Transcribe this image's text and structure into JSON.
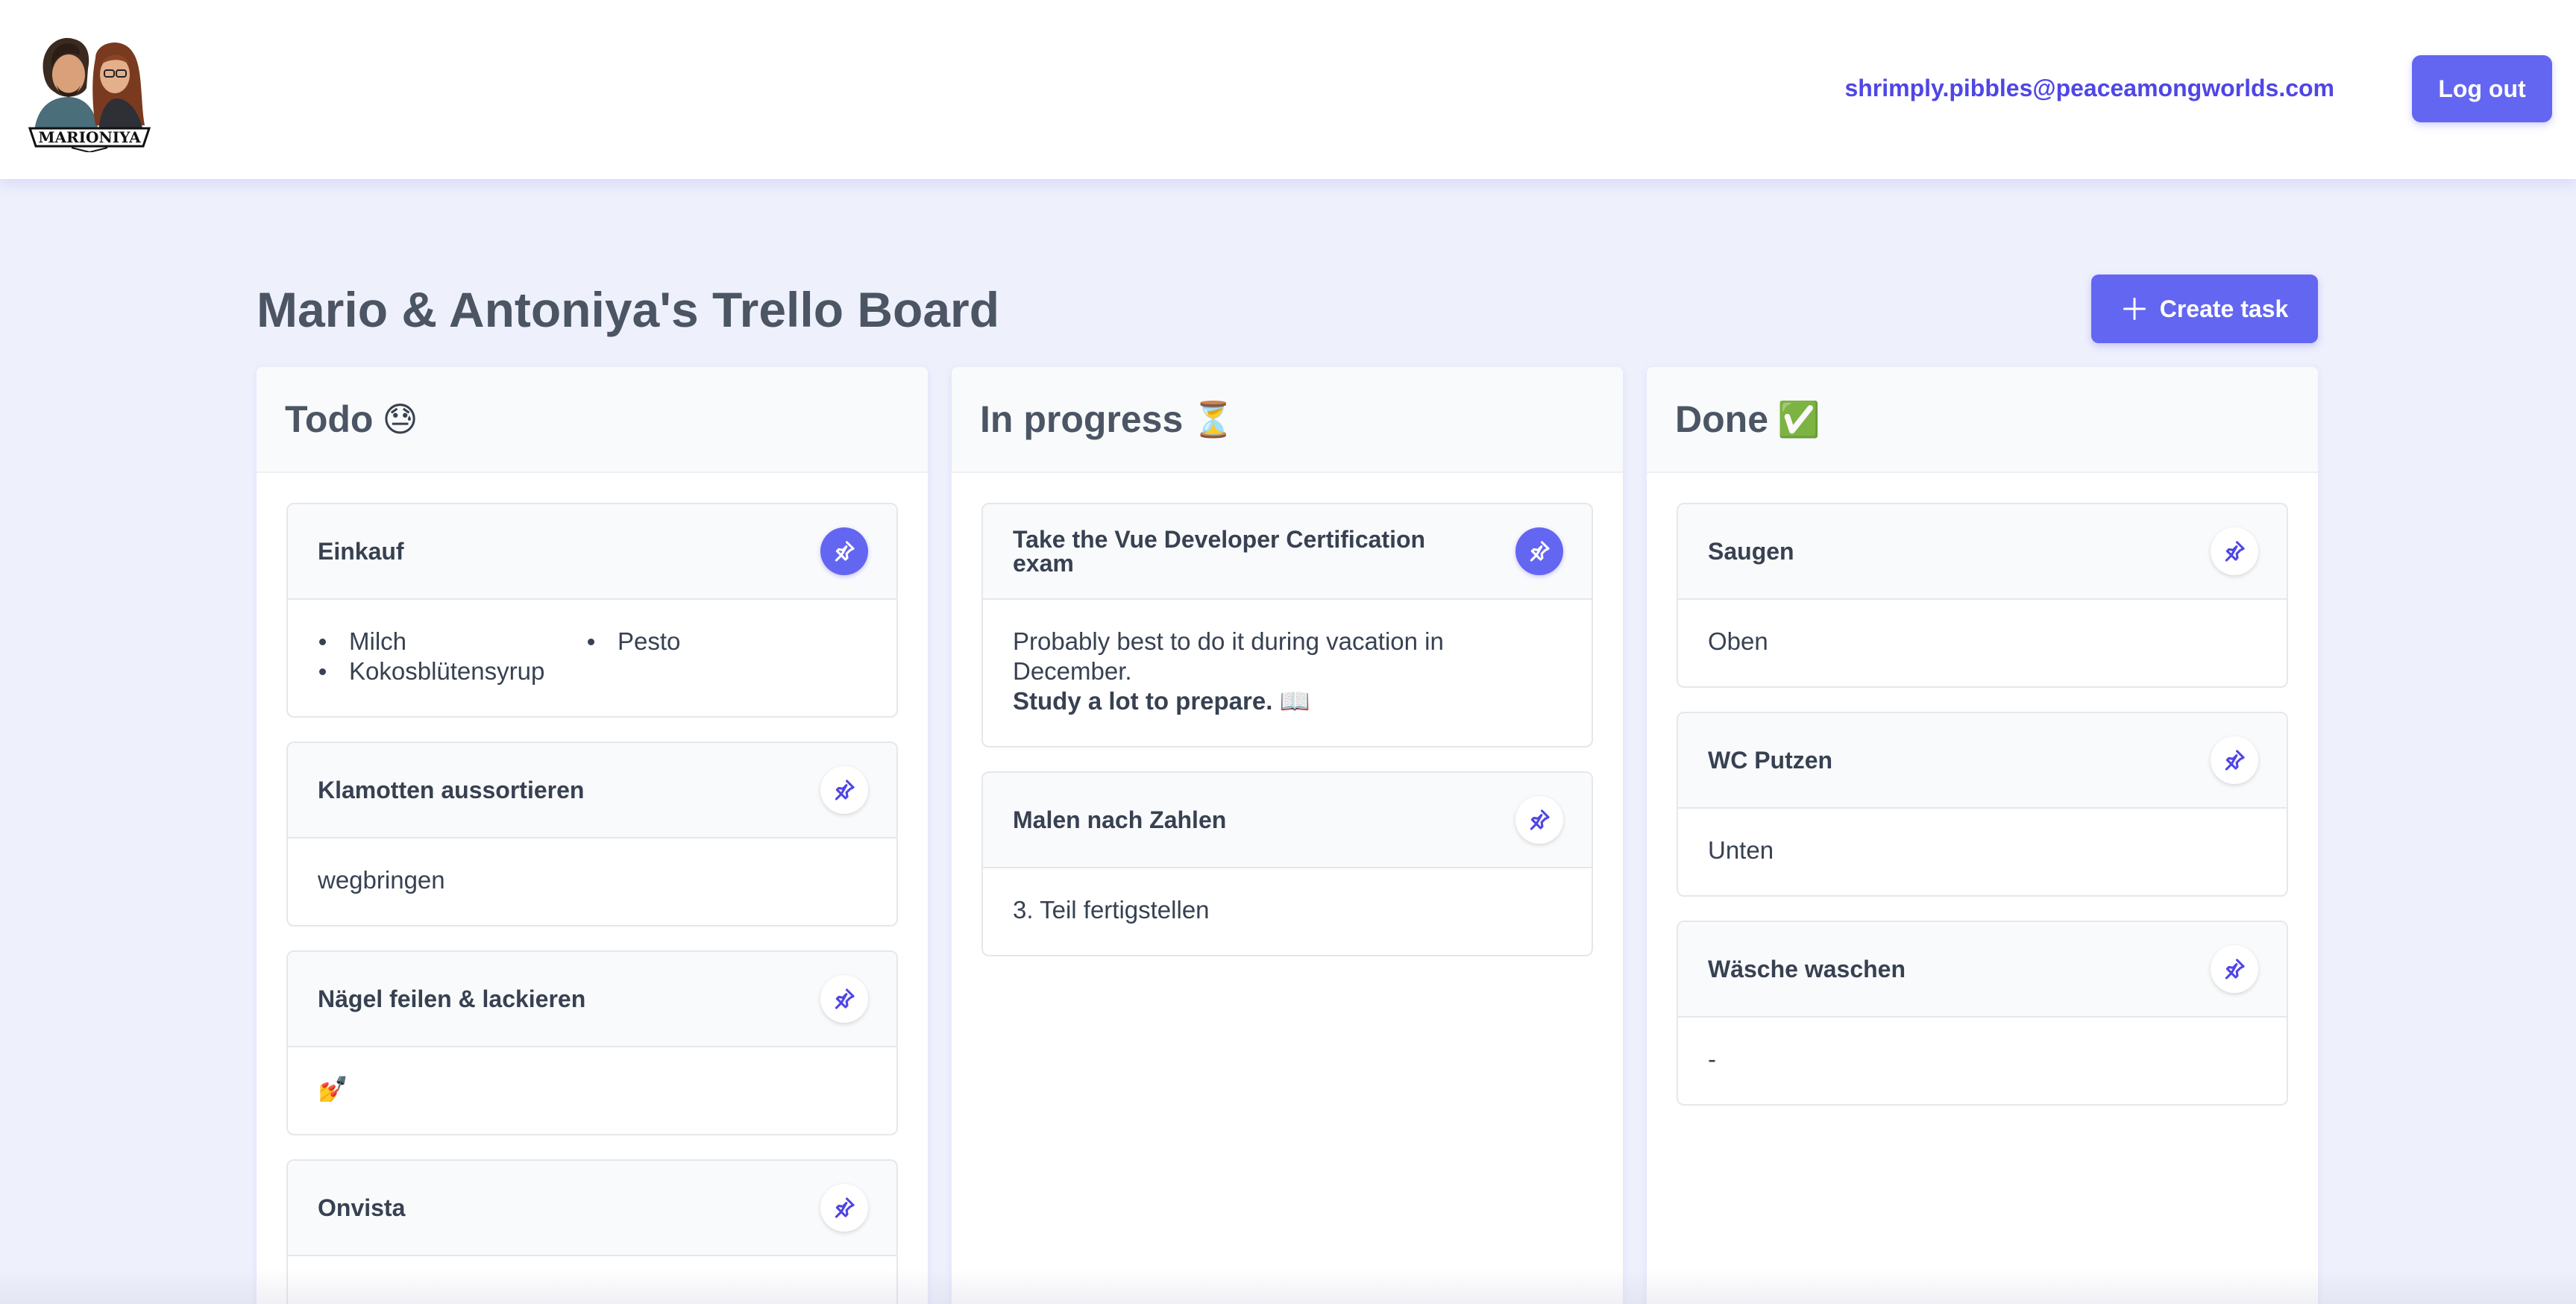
{
  "header": {
    "logo_text": "MARIONIYA",
    "user_email": "shrimply.pibbles@peaceamongworlds.com",
    "logout_label": "Log out"
  },
  "board": {
    "title": "Mario & Antoniya's Trello Board",
    "create_label": "Create task"
  },
  "columns": [
    {
      "title": "Todo",
      "emoji": "😓",
      "cards": [
        {
          "title": "Einkauf",
          "pinned": true,
          "items": [
            "Milch",
            "Pesto",
            "Kokosblütensyrup"
          ]
        },
        {
          "title": "Klamotten aussortieren",
          "pinned": false,
          "body": "wegbringen"
        },
        {
          "title": "Nägel feilen & lackieren",
          "pinned": false,
          "body": "💅"
        },
        {
          "title": "Onvista",
          "pinned": false,
          "body": ""
        }
      ]
    },
    {
      "title": "In progress",
      "emoji": "⏳",
      "cards": [
        {
          "title": "Take the Vue Developer Certification exam",
          "pinned": true,
          "body": "Probably best to do it during vacation in December.",
          "body_bold": "Study a lot to prepare. 📖"
        },
        {
          "title": "Malen nach Zahlen",
          "pinned": false,
          "body": "3. Teil fertigstellen"
        }
      ]
    },
    {
      "title": "Done",
      "emoji": "✅",
      "cards": [
        {
          "title": "Saugen",
          "pinned": false,
          "body": "Oben"
        },
        {
          "title": "WC Putzen",
          "pinned": false,
          "body": "Unten"
        },
        {
          "title": "Wäsche waschen",
          "pinned": false,
          "body": "-"
        }
      ]
    }
  ],
  "colors": {
    "accent": "#6366f1",
    "accent_dark": "#4f46e5",
    "page_background": "#eef0fc",
    "heading_text": "#4b5563"
  },
  "icons": {
    "pin": "pin-icon",
    "plus": "plus-icon"
  }
}
